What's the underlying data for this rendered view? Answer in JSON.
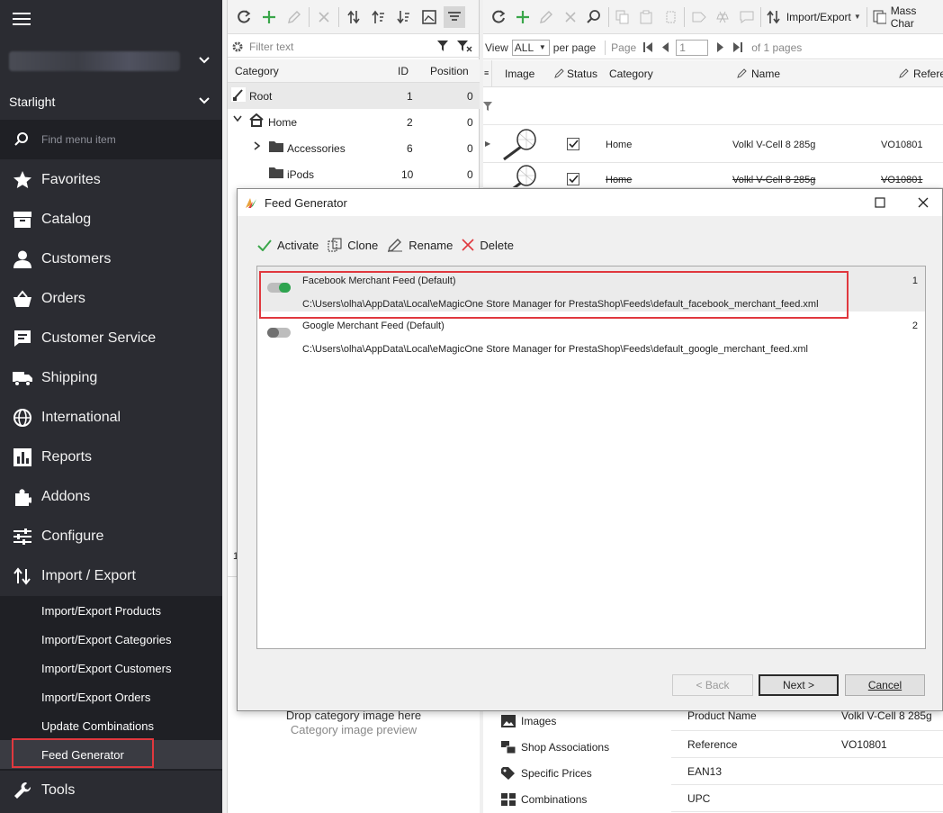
{
  "sidebar": {
    "store_selector": "",
    "store_name": "Starlight",
    "find_placeholder": "Find menu item",
    "items": [
      {
        "label": "Favorites",
        "icon": "star-icon"
      },
      {
        "label": "Catalog",
        "icon": "catalog-icon"
      },
      {
        "label": "Customers",
        "icon": "person-icon"
      },
      {
        "label": "Orders",
        "icon": "basket-icon"
      },
      {
        "label": "Customer Service",
        "icon": "chat-icon"
      },
      {
        "label": "Shipping",
        "icon": "truck-icon"
      },
      {
        "label": "International",
        "icon": "globe-icon"
      },
      {
        "label": "Reports",
        "icon": "chart-icon"
      },
      {
        "label": "Addons",
        "icon": "puzzle-icon"
      },
      {
        "label": "Configure",
        "icon": "sliders-icon"
      },
      {
        "label": "Import / Export",
        "icon": "import-export-icon"
      }
    ],
    "submenu": [
      "Import/Export Products",
      "Import/Export Categories",
      "Import/Export Customers",
      "Import/Export Orders",
      "Update Combinations",
      "Feed Generator"
    ],
    "tools": "Tools"
  },
  "categories": {
    "filter_placeholder": "Filter text",
    "headers": {
      "category": "Category",
      "id": "ID",
      "position": "Position"
    },
    "rows": [
      {
        "name": "Root",
        "id": "1",
        "position": "0"
      },
      {
        "name": "Home",
        "id": "2",
        "position": "0"
      },
      {
        "name": "Accessories",
        "id": "6",
        "position": "0"
      },
      {
        "name": "iPods",
        "id": "10",
        "position": "0"
      }
    ],
    "drop_text": "Drop category image here",
    "preview_text": "Category image preview",
    "stub": "1"
  },
  "products": {
    "toolbar": {
      "import_export": "Import/Export",
      "mass": "Mass Char"
    },
    "pager": {
      "view": "View",
      "view_value": "ALL",
      "per_page": "per page",
      "page": "Page",
      "page_value": "1",
      "of_pages": "of 1 pages"
    },
    "headers": {
      "image": "Image",
      "status": "Status",
      "category": "Category",
      "name": "Name",
      "reference": "Refere"
    },
    "rows": [
      {
        "category": "Home",
        "name": "Volkl V-Cell 8 285g",
        "reference": "VO10801"
      },
      {
        "category": "Home",
        "name": "Volkl V-Cell 8 285g",
        "reference": "VO10801"
      }
    ],
    "bottom_list": [
      "Images",
      "Shop Associations",
      "Specific Prices",
      "Combinations"
    ],
    "props": [
      {
        "label": "Product Name",
        "value": "Volkl V-Cell 8 285g"
      },
      {
        "label": "Reference",
        "value": "VO10801"
      },
      {
        "label": "EAN13",
        "value": ""
      },
      {
        "label": "UPC",
        "value": ""
      }
    ]
  },
  "dialog": {
    "title": "Feed Generator",
    "toolbar": {
      "activate": "Activate",
      "clone": "Clone",
      "rename": "Rename",
      "delete": "Delete"
    },
    "feeds": [
      {
        "name": "Facebook Merchant Feed (Default)",
        "path": "C:\\Users\\olha\\AppData\\Local\\eMagicOne Store Manager for PrestaShop\\Feeds\\default_facebook_merchant_feed.xml",
        "num": "1",
        "active": true
      },
      {
        "name": "Google Merchant Feed (Default)",
        "path": "C:\\Users\\olha\\AppData\\Local\\eMagicOne Store Manager for PrestaShop\\Feeds\\default_google_merchant_feed.xml",
        "num": "2",
        "active": false
      }
    ],
    "back": "< Back",
    "next": "Next >",
    "cancel": "Cancel"
  },
  "colors": {
    "sidebar": "#2b2c32",
    "highlight": "#e0383e",
    "toggle_on": "#2ea44f",
    "accent_green": "#3aa64a"
  }
}
